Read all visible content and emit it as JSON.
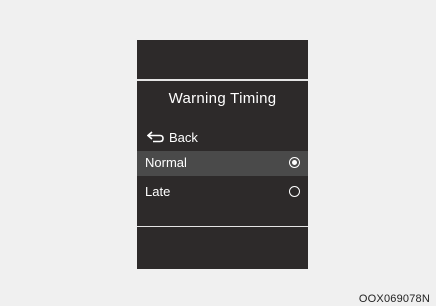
{
  "screen": {
    "title": "Warning Timing",
    "back_label": "Back",
    "options": [
      {
        "label": "Normal",
        "selected": true
      },
      {
        "label": "Late",
        "selected": false
      }
    ]
  },
  "caption": "OOX069078N",
  "colors": {
    "screen_bg": "#2d2a2a",
    "highlight_bg": "#4a4a4a",
    "text": "#ffffff",
    "page_bg": "#f0f0f0"
  },
  "icons": {
    "back": "return-arrow-icon",
    "radio_selected": "radio-selected-icon",
    "radio_unselected": "radio-unselected-icon"
  }
}
